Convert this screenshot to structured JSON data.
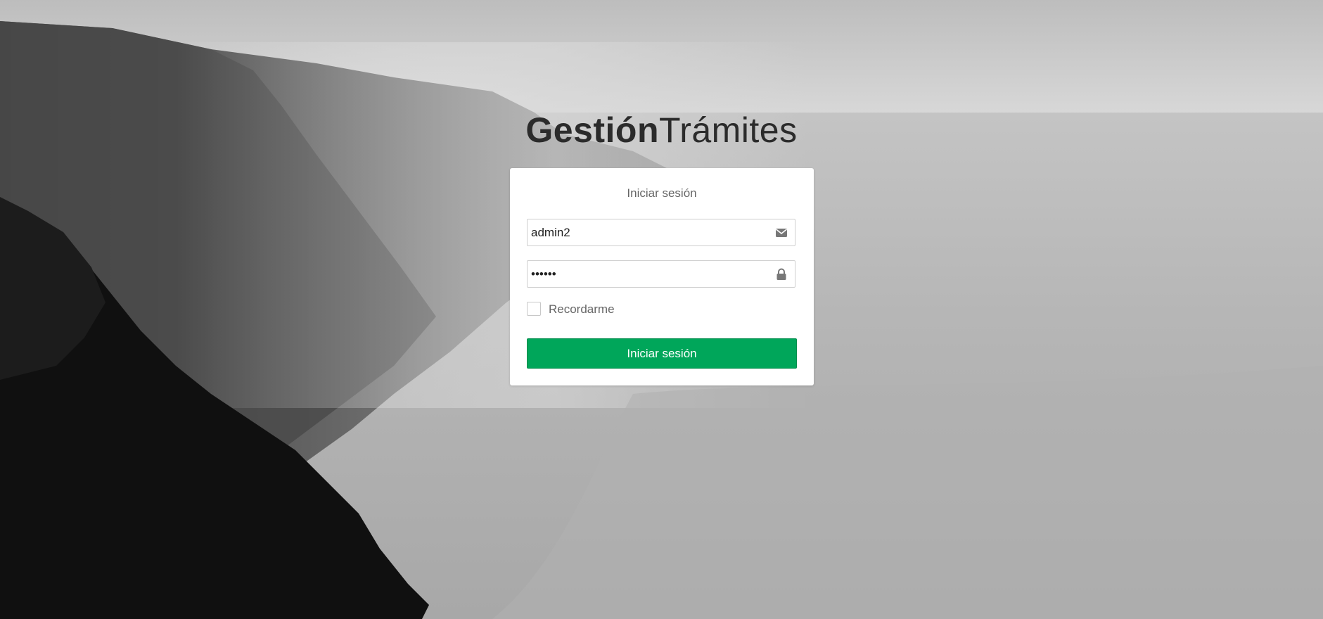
{
  "brand": {
    "bold": "Gestión",
    "light": "Trámites"
  },
  "login": {
    "title": "Iniciar sesión",
    "username_value": "admin2",
    "password_value": "••••••",
    "remember_label": "Recordarme",
    "submit_label": "Iniciar sesión"
  },
  "icons": {
    "username_icon": "envelope-icon",
    "password_icon": "lock-icon"
  },
  "colors": {
    "button": "#00a65a",
    "panel": "#ffffff",
    "brand_text": "#2b2b2b"
  }
}
